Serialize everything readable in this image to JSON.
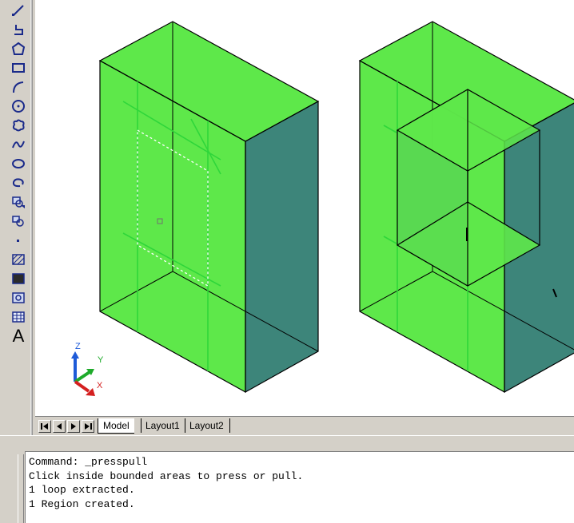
{
  "toolbar": {
    "tools": [
      {
        "name": "line-icon"
      },
      {
        "name": "polyline-icon"
      },
      {
        "name": "polygon-icon"
      },
      {
        "name": "rectangle-icon"
      },
      {
        "name": "arc-icon"
      },
      {
        "name": "circle-icon"
      },
      {
        "name": "revision-cloud-icon"
      },
      {
        "name": "spline-icon"
      },
      {
        "name": "ellipse-icon"
      },
      {
        "name": "ellipse-arc-icon"
      },
      {
        "name": "insert-block-icon"
      },
      {
        "name": "make-block-icon"
      },
      {
        "name": "point-icon"
      },
      {
        "name": "hatch-icon"
      },
      {
        "name": "gradient-icon"
      },
      {
        "name": "region-icon"
      },
      {
        "name": "table-icon"
      },
      {
        "name": "multiline-text-icon",
        "label": "A"
      }
    ]
  },
  "ucs": {
    "z_label": "Z",
    "y_label": "Y",
    "x_label": "X"
  },
  "tabs": [
    {
      "label": "Model",
      "active": true
    },
    {
      "label": "Layout1",
      "active": false
    },
    {
      "label": "Layout2",
      "active": false
    }
  ],
  "command_history": [
    "Command: _presspull",
    "Click inside bounded areas to press or pull.",
    "1 loop extracted.",
    "1 Region created."
  ],
  "colors": {
    "face_green": "#5ee84a",
    "face_teal": "#3d857a",
    "edge": "#000000",
    "highlight_green": "#2fd63a",
    "chrome": "#d4d0c8"
  }
}
